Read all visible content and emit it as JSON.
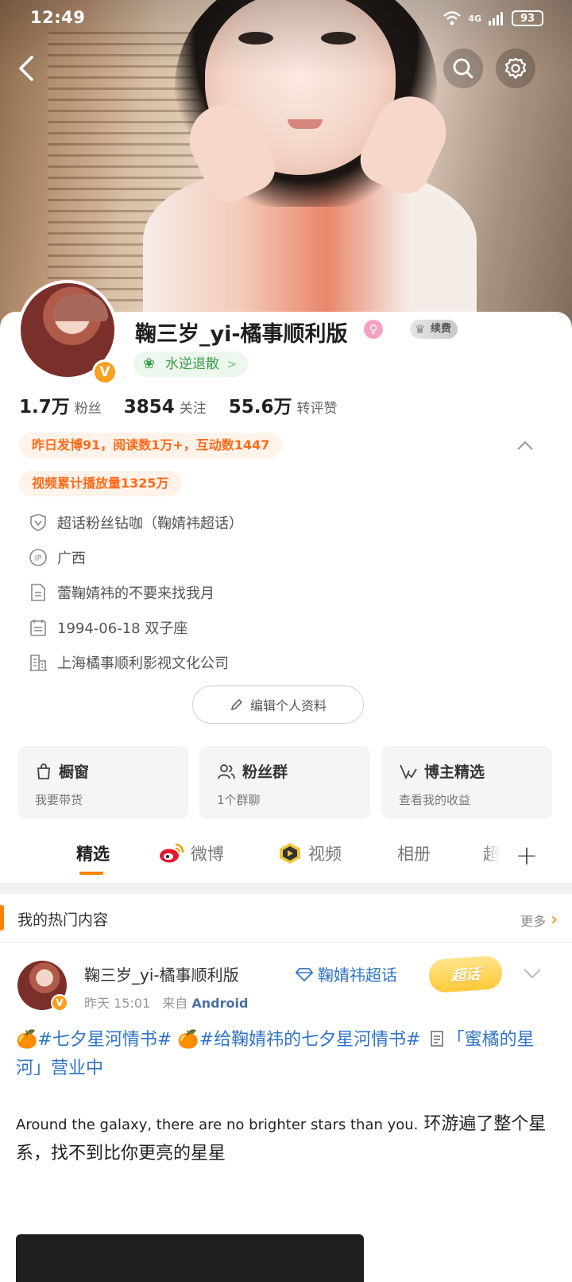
{
  "status_bar": {
    "time": "12:49",
    "network": "4G",
    "battery": "93"
  },
  "profile": {
    "name": "鞠三岁_yi-橘事顺利版",
    "gender_symbol": "♀",
    "vip_label": "续费",
    "rank_label": "水逆退散",
    "rank_chevron": ">",
    "verified_mark": "V",
    "stats": [
      {
        "value": "1.7万",
        "label": "粉丝"
      },
      {
        "value": "3854",
        "label": "关注"
      },
      {
        "value": "55.6万",
        "label": "转评赞"
      }
    ],
    "highlight_1": "昨日发博91，阅读数1万+，互动数1447",
    "highlight_2": "视频累计播放量1325万",
    "collapse_icon": "chevron-up",
    "info": {
      "fan_title": "超话粉丝钻咖（鞠婧祎超话）",
      "ip_location": "广西",
      "bio": "蕾鞠婧祎的不要来找我月",
      "birthday": "1994-06-18 双子座",
      "company": "上海橘事顺利影视文化公司"
    },
    "edit_label": "编辑个人资料"
  },
  "tiles": [
    {
      "title": "橱窗",
      "subtitle": "我要带货",
      "icon": "bag-icon"
    },
    {
      "title": "粉丝群",
      "subtitle": "1个群聊",
      "icon": "group-icon"
    },
    {
      "title": "博主精选",
      "subtitle": "查看我的收益",
      "icon": "v-check-icon"
    }
  ],
  "tabs": [
    {
      "label": "精选",
      "active": true
    },
    {
      "label": "微博",
      "icon": "weibo-icon"
    },
    {
      "label": "视频",
      "icon": "video-icon"
    },
    {
      "label": "相册"
    },
    {
      "label": "超"
    }
  ],
  "tab_add": "+",
  "hot": {
    "title": "我的热门内容",
    "more": "更多",
    "chevron": "›"
  },
  "post": {
    "author": "鞠三岁_yi-橘事顺利版",
    "topic": "鞠婧祎超话",
    "badge": "超话",
    "time": "昨天 15:01",
    "source_prefix": "来自",
    "source": "Android",
    "verified_mark": "V",
    "menu_icon": "chevron-down",
    "tag1": "#七夕星河情书#",
    "tag2": "#给鞠婧祎的七夕星河情书#",
    "inline": "「蜜橘的星河」营业中",
    "en_text": "Around the galaxy, there are no brighter stars than you.",
    "cn_text": "环游遍了整个星系，找不到比你更亮的星星",
    "orange_emoji": "🍊"
  },
  "colors": {
    "accent": "#ff8200",
    "link": "#2f74c8",
    "highlight": "#ff6a1a",
    "highlight_bg": "#fff3ea"
  }
}
